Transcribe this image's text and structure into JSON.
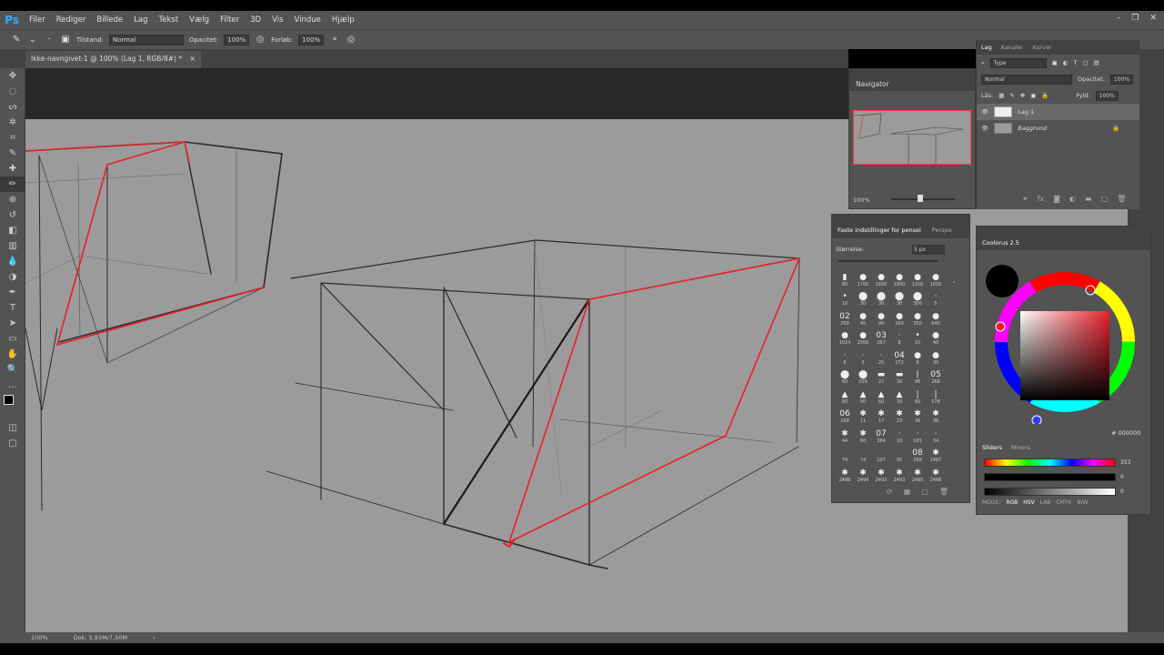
{
  "app": {
    "logo": "Ps"
  },
  "menu": [
    "Filer",
    "Rediger",
    "Billede",
    "Lag",
    "Tekst",
    "Vælg",
    "Filter",
    "3D",
    "Vis",
    "Vindue",
    "Hjælp"
  ],
  "window_controls": [
    "–",
    "❐",
    "✕"
  ],
  "options": {
    "mode_label": "Tilstand:",
    "mode_value": "Normal",
    "opacity_label": "Opacitet:",
    "opacity_value": "100%",
    "flow_label": "Forløb:",
    "flow_value": "100%"
  },
  "document": {
    "tab_title": "Ikke-navngivet-1 @ 100% (Lag 1, RGB/8#) *",
    "close": "×"
  },
  "tools": [
    "move-icon",
    "marquee-icon",
    "lasso-icon",
    "magic-wand-icon",
    "crop-icon",
    "eyedropper-icon",
    "healing-icon",
    "brush-icon",
    "stamp-icon",
    "history-brush-icon",
    "eraser-icon",
    "gradient-icon",
    "blur-icon",
    "dodge-icon",
    "pen-icon",
    "type-icon",
    "path-select-icon",
    "shape-icon",
    "hand-icon",
    "zoom-icon",
    "more-icon"
  ],
  "tool_glyphs": [
    "✥",
    "◌",
    "ᔕ",
    "✲",
    "⌗",
    "✎",
    "✚",
    "✏",
    "⊕",
    "↺",
    "◧",
    "▥",
    "💧",
    "◑",
    "✒",
    "T",
    "➤",
    "▭",
    "✋",
    "🔍",
    "…"
  ],
  "status": {
    "zoom": "100%",
    "doc": "Dok: 5,93M/7,50M",
    "arrow": "›"
  },
  "navigator": {
    "title": "Navigator",
    "zoom": "100%"
  },
  "layers": {
    "tabs": [
      "Lag",
      "Kanaler",
      "Kurver"
    ],
    "kind_filter": "Type",
    "blend_mode": "Normal",
    "opacity_label": "Opacitet:",
    "opacity_value": "100%",
    "lock_label": "Lås:",
    "fill_label": "Fyld:",
    "fill_value": "100%",
    "items": [
      {
        "name": "Lag 1"
      },
      {
        "name": "Baggrund"
      }
    ]
  },
  "brush_presets": {
    "tabs": [
      "Faste indstillinger for pensel",
      "Perspe"
    ],
    "size_label": "Størrelse:",
    "size_value": "5 px",
    "presets": [
      {
        "g": "▮",
        "n": "80"
      },
      {
        "g": "●",
        "n": "1700"
      },
      {
        "g": "●",
        "n": "1800"
      },
      {
        "g": "●",
        "n": "1800"
      },
      {
        "g": "●",
        "n": "1200"
      },
      {
        "g": "●",
        "n": "1000"
      },
      {
        "g": "·",
        "n": ""
      },
      {
        "g": "•",
        "n": "10"
      },
      {
        "g": "⬤",
        "n": "30"
      },
      {
        "g": "⬤",
        "n": "30"
      },
      {
        "g": "⬤",
        "n": "30"
      },
      {
        "g": "⬤",
        "n": "300"
      },
      {
        "g": "·",
        "n": "5"
      },
      {
        "g": "",
        "n": ""
      },
      {
        "g": "02",
        "n": "268"
      },
      {
        "g": "●",
        "n": "45"
      },
      {
        "g": "●",
        "n": "90"
      },
      {
        "g": "●",
        "n": "160"
      },
      {
        "g": "●",
        "n": "350"
      },
      {
        "g": "●",
        "n": "640"
      },
      {
        "g": "",
        "n": ""
      },
      {
        "g": "●",
        "n": "1024"
      },
      {
        "g": "●",
        "n": "2500"
      },
      {
        "g": "03",
        "n": "267"
      },
      {
        "g": "·",
        "n": "8"
      },
      {
        "g": "•",
        "n": "10"
      },
      {
        "g": "●",
        "n": "40"
      },
      {
        "g": "",
        "n": ""
      },
      {
        "g": "·",
        "n": "6"
      },
      {
        "g": "·",
        "n": "3"
      },
      {
        "g": "·",
        "n": "25"
      },
      {
        "g": "04",
        "n": "272"
      },
      {
        "g": "●",
        "n": "8"
      },
      {
        "g": "●",
        "n": "30"
      },
      {
        "g": "",
        "n": ""
      },
      {
        "g": "⬤",
        "n": "60"
      },
      {
        "g": "⬤",
        "n": "100"
      },
      {
        "g": "▬",
        "n": "27"
      },
      {
        "g": "▬",
        "n": "30"
      },
      {
        "g": "|",
        "n": "96"
      },
      {
        "g": "05",
        "n": "268"
      },
      {
        "g": "",
        "n": ""
      },
      {
        "g": "▲",
        "n": "80"
      },
      {
        "g": "▲",
        "n": "50"
      },
      {
        "g": "▲",
        "n": "60"
      },
      {
        "g": "▲",
        "n": "30"
      },
      {
        "g": "|",
        "n": "60"
      },
      {
        "g": "|",
        "n": "578"
      },
      {
        "g": "",
        "n": ""
      },
      {
        "g": "06",
        "n": "269"
      },
      {
        "g": "✱",
        "n": "11"
      },
      {
        "g": "✱",
        "n": "17"
      },
      {
        "g": "✱",
        "n": "23"
      },
      {
        "g": "✱",
        "n": "36"
      },
      {
        "g": "✱",
        "n": "36"
      },
      {
        "g": "",
        "n": ""
      },
      {
        "g": "✱",
        "n": "44"
      },
      {
        "g": "✱",
        "n": "60"
      },
      {
        "g": "07",
        "n": "264"
      },
      {
        "g": "·",
        "n": "10"
      },
      {
        "g": "·",
        "n": "165"
      },
      {
        "g": "·",
        "n": "34"
      },
      {
        "g": "",
        "n": ""
      },
      {
        "g": "",
        "n": "74"
      },
      {
        "g": "",
        "n": "74"
      },
      {
        "g": "",
        "n": "107"
      },
      {
        "g": "",
        "n": "95"
      },
      {
        "g": "08",
        "n": "268"
      },
      {
        "g": "✱",
        "n": "2487"
      },
      {
        "g": "",
        "n": ""
      },
      {
        "g": "✱",
        "n": "2488"
      },
      {
        "g": "✱",
        "n": "2494"
      },
      {
        "g": "✱",
        "n": "2492"
      },
      {
        "g": "✱",
        "n": "2493"
      },
      {
        "g": "✱",
        "n": "2465"
      },
      {
        "g": "✱",
        "n": "2466"
      },
      {
        "g": "",
        "n": ""
      }
    ]
  },
  "coolorus": {
    "title": "Coolorus 2.5",
    "hex": "# 000000",
    "tabs": [
      "Sliders",
      "Mixers"
    ],
    "slider_values": [
      "353",
      "0",
      "0"
    ],
    "modes": [
      "MODE:",
      "RGB",
      "HSV",
      "LAB",
      "CMYK",
      "B/W"
    ]
  },
  "colors": {
    "ui_bg": "#535353",
    "dark_bg": "#424242",
    "canvas": "#9b9b9b",
    "red_line": "#e8202a"
  }
}
